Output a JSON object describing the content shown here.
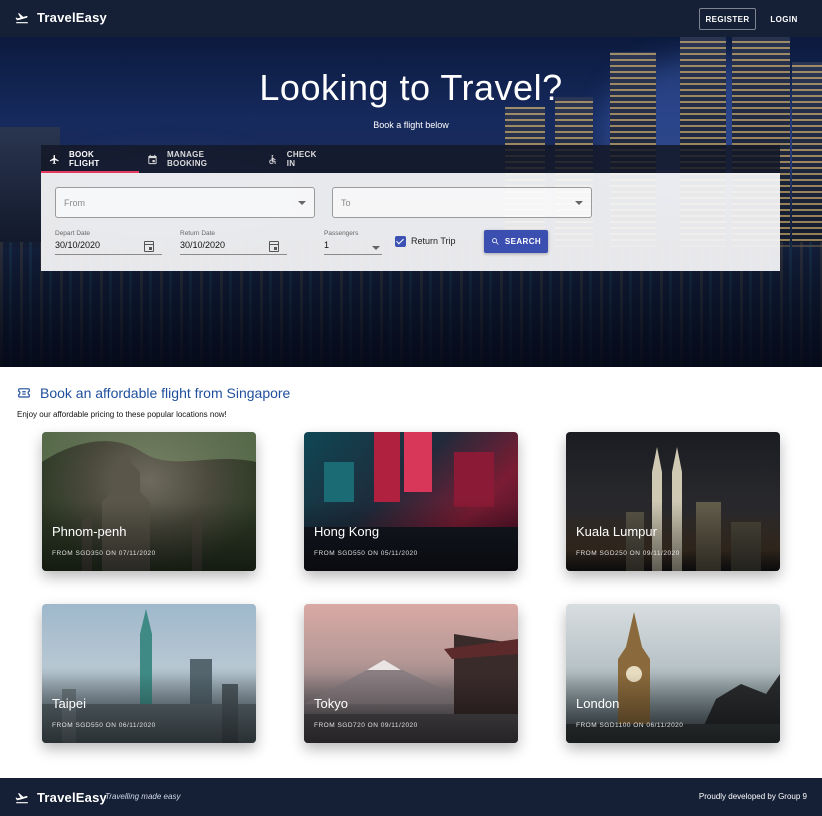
{
  "navbar": {
    "brand": "TravelEasy",
    "register_label": "REGISTER",
    "login_label": "LOGIN"
  },
  "hero": {
    "title": "Looking to Travel?",
    "subtitle": "Book a flight below"
  },
  "booking": {
    "tabs": [
      {
        "label": "BOOK FLIGHT",
        "icon": "airplane-icon",
        "active": true
      },
      {
        "label": "MANAGE BOOKING",
        "icon": "calendar-icon",
        "active": false
      },
      {
        "label": "CHECK IN",
        "icon": "accessible-icon",
        "active": false
      }
    ],
    "from_placeholder": "From",
    "to_placeholder": "To",
    "depart": {
      "label": "Depart Date",
      "value": "30/10/2020"
    },
    "return": {
      "label": "Return Date",
      "value": "30/10/2020"
    },
    "passengers": {
      "label": "Passengers",
      "value": "1"
    },
    "return_trip": {
      "label": "Return Trip",
      "checked": true
    },
    "search_label": "SEARCH"
  },
  "section": {
    "title": "Book an affordable flight from Singapore",
    "subtitle": "Enjoy our affordable pricing to these popular locations now!",
    "icon": "ticket-icon"
  },
  "destinations": [
    {
      "city": "Phnom-penh",
      "price": "FROM SGD350 ON 07/11/2020"
    },
    {
      "city": "Hong Kong",
      "price": "FROM SGD550 ON 05/11/2020"
    },
    {
      "city": "Kuala Lumpur",
      "price": "FROM SGD250 ON 09/11/2020"
    },
    {
      "city": "Taipei",
      "price": "FROM SGD550 ON 06/11/2020"
    },
    {
      "city": "Tokyo",
      "price": "FROM SGD720 ON 09/11/2020"
    },
    {
      "city": "London",
      "price": "FROM SGD1100 ON 06/11/2020"
    }
  ],
  "footer": {
    "brand": "TravelEasy",
    "tagline": "Travelling made easy",
    "credit": "Proudly developed by Group 9"
  },
  "colors": {
    "navbar_bg": "#152036",
    "accent": "#3a4fb0",
    "tab_indicator": "#e53960",
    "section_title": "#1f4f9c"
  }
}
